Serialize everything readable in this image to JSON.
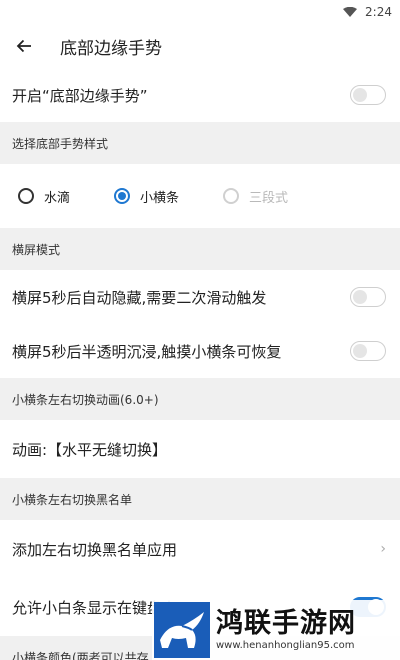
{
  "status": {
    "time": "2:24"
  },
  "header": {
    "title": "底部边缘手势"
  },
  "enable_row": {
    "label": "开启“底部边缘手势”",
    "on": false
  },
  "style_section": {
    "label": "选择底部手势样式"
  },
  "style_options": [
    {
      "label": "水滴",
      "selected": false,
      "disabled": false
    },
    {
      "label": "小横条",
      "selected": true,
      "disabled": false
    },
    {
      "label": "三段式",
      "selected": false,
      "disabled": true
    }
  ],
  "landscape_section": {
    "label": "横屏模式"
  },
  "landscape_rows": [
    {
      "label": "横屏5秒后自动隐藏,需要二次滑动触发",
      "on": false
    },
    {
      "label": "横屏5秒后半透明沉浸,触摸小横条可恢复",
      "on": false
    }
  ],
  "anim_section": {
    "label": "小横条左右切换动画(6.0+)"
  },
  "anim_row": {
    "label": "动画:【水平无缝切换】"
  },
  "blacklist_section": {
    "label": "小横条左右切换黑名单"
  },
  "blacklist_row": {
    "label": "添加左右切换黑名单应用"
  },
  "keyboard_row": {
    "label": "允许小白条显示在键盘上",
    "on": true
  },
  "color_section": {
    "label": "小横条颜色(两者可以共存,"
  },
  "watermark": {
    "brand": "鸿联手游网",
    "url": "www.henanhonglian95.com"
  }
}
